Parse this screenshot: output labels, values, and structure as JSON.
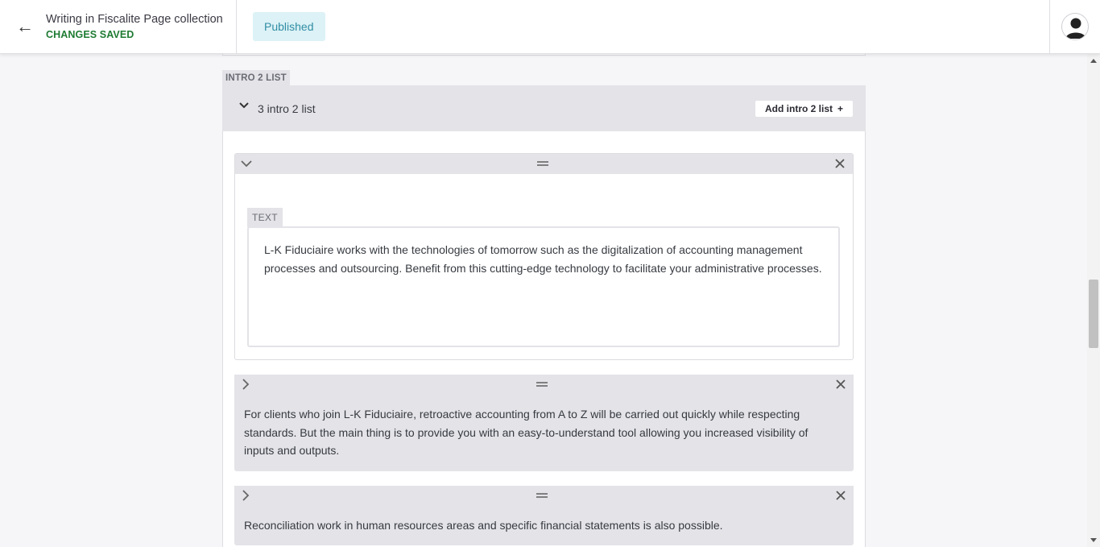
{
  "header": {
    "back_icon": "arrow-left-icon",
    "title": "Writing in Fiscalite Page collection",
    "status": "CHANGES SAVED",
    "published_label": "Published",
    "avatar_icon": "user-avatar-icon"
  },
  "intro_list": {
    "section_label": "INTRO 2 LIST",
    "count_label": "3 intro 2 list",
    "add_label": "Add intro 2 list",
    "add_icon": "+",
    "items": [
      {
        "expanded": true,
        "field_label": "TEXT",
        "text": "L-K Fiduciaire works with the technologies of tomorrow such as the digitalization of accounting management processes and outsourcing. Benefit from this cutting-edge technology to facilitate your administrative processes."
      },
      {
        "expanded": false,
        "text": "For clients who join L-K Fiduciaire, retroactive accounting from A to Z will be carried out quickly while respecting standards. But the main thing is to provide you with an easy-to-understand tool allowing you increased visibility of inputs and outputs."
      },
      {
        "expanded": false,
        "text": "Reconciliation work in human resources areas and specific financial statements is also possible."
      }
    ]
  },
  "colors": {
    "status_green": "#1e7b32",
    "published_bg": "#dcf2f6",
    "published_text": "#318da5",
    "panel_gray": "#e3e3e8"
  }
}
